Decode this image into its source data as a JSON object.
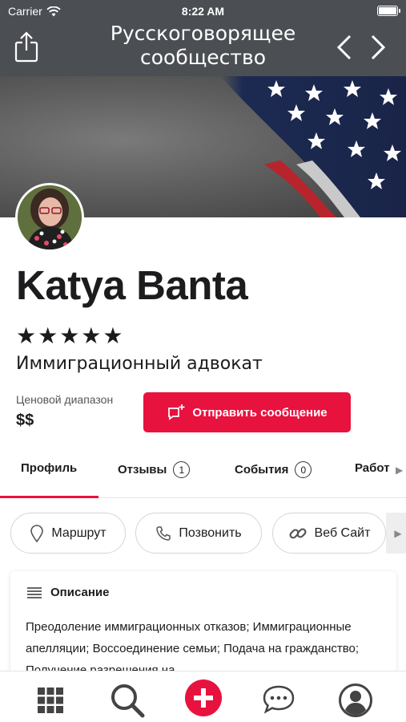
{
  "status_bar": {
    "carrier": "Carrier",
    "time": "8:22 AM"
  },
  "header": {
    "title": "Русскоговорящее сообщество"
  },
  "profile": {
    "name": "Katya Banta",
    "rating_stars": "★★★★★",
    "rating": 5,
    "profession": "Иммиграционный адвокат",
    "price_label": "Ценовой диапазон",
    "price_value": "$$",
    "send_message_label": "Отправить сообщение"
  },
  "tabs": [
    {
      "label": "Профиль",
      "count": null
    },
    {
      "label": "Отзывы",
      "count": "1"
    },
    {
      "label": "События",
      "count": "0"
    },
    {
      "label": "Работ",
      "count": null
    }
  ],
  "actions": [
    {
      "label": "Маршрут",
      "icon": "location-pin-icon"
    },
    {
      "label": "Позвонить",
      "icon": "phone-icon"
    },
    {
      "label": "Веб Сайт",
      "icon": "link-icon"
    }
  ],
  "description": {
    "title": "Описание",
    "text": "Преодоление иммиграционных отказов; Иммиграционные апелляции; Воссоединение семьи; Подача на гражданство; Получение разрешения на"
  },
  "tabbar": [
    "grid-icon",
    "search-icon",
    "add-icon",
    "chat-icon",
    "profile-icon"
  ],
  "colors": {
    "accent": "#e8123e",
    "header_bg": "#4b4f54"
  }
}
